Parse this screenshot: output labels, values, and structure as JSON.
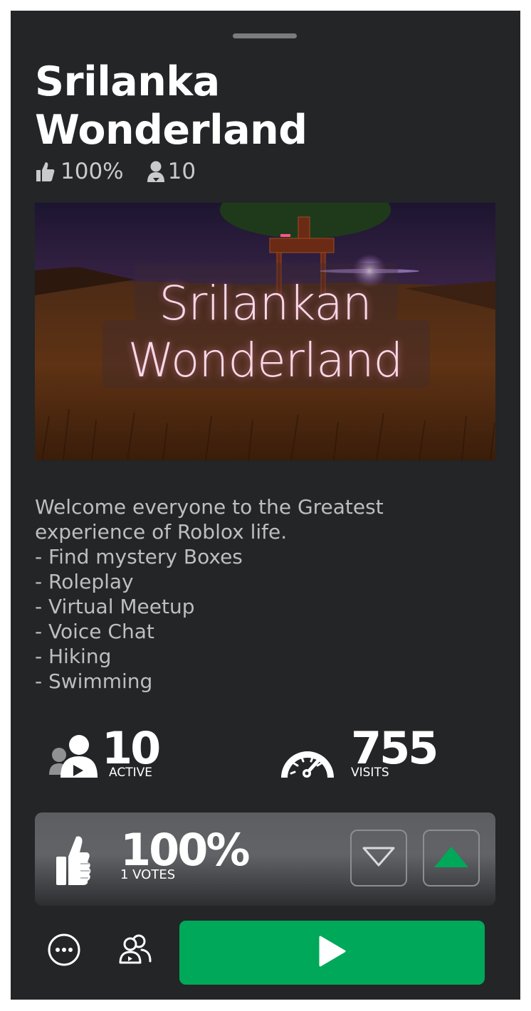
{
  "game": {
    "title_lines": [
      "Srilanka",
      "Wonderland"
    ],
    "rating_summary": "100%",
    "players_summary": "10"
  },
  "thumbnail": {
    "text_lines": [
      "Srilankan",
      "Wonderland"
    ]
  },
  "description": {
    "lines": [
      "Welcome everyone to the Greatest",
      "experience of Roblox life.",
      "- Find mystery Boxes",
      "- Roleplay",
      "- Virtual Meetup",
      "- Voice Chat",
      "- Hiking",
      "- Swimming"
    ]
  },
  "stats": {
    "active_value": "10",
    "active_label": "ACTIVE",
    "visits_value": "755",
    "visits_label": "VISITS"
  },
  "votes": {
    "percent": "100%",
    "count_label": "1 VOTES"
  },
  "icons": {
    "rating": "thumbs-up-icon",
    "players": "players-icon",
    "visits": "speedometer-icon",
    "more": "more-options-icon",
    "friends": "friends-icon",
    "play": "play-icon",
    "downvote": "triangle-down-icon",
    "upvote": "triangle-up-icon"
  },
  "colors": {
    "background": "#232527",
    "play_button": "#00a85a",
    "upvote_active": "#00a85a",
    "text_primary": "#ffffff",
    "text_secondary": "#bcbec1"
  }
}
